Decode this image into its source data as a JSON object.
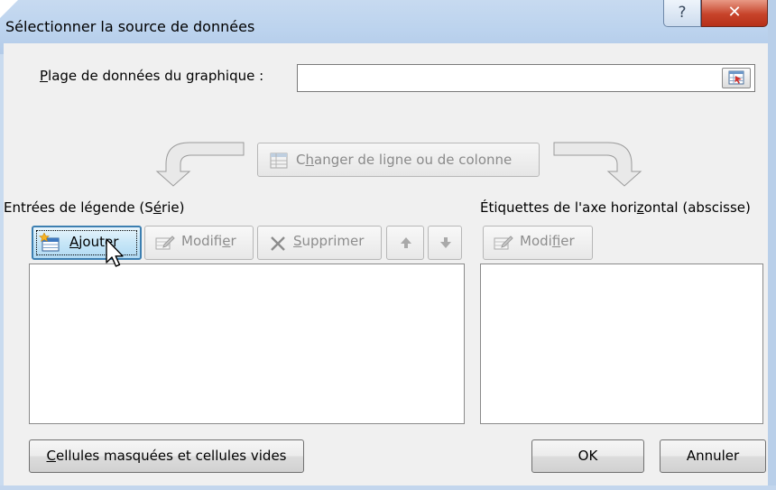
{
  "window": {
    "title": "Sélectionner la source de données",
    "help_glyph": "?",
    "close_glyph": "✕"
  },
  "range": {
    "label_mnemonic": "P",
    "label_rest": "lage de données du graphique :",
    "value": ""
  },
  "switch_button": {
    "pre": "C",
    "mnemonic": "h",
    "post": "anger de ligne ou de colonne",
    "enabled": false
  },
  "legend": {
    "label_pre": "Entrées de légende (S",
    "label_mnemonic": "é",
    "label_post": "rie)",
    "add": {
      "mnemonic": "A",
      "rest": "jouter"
    },
    "edit": {
      "pre": "Modifi",
      "mnemonic": "e",
      "post": "r"
    },
    "delete": {
      "mnemonic": "S",
      "rest": "upprimer"
    },
    "items": []
  },
  "axis": {
    "label_pre": "Étiquettes de l'axe hori",
    "label_mnemonic": "z",
    "label_post": "ontal (abscisse)",
    "edit": {
      "pre": "Modi",
      "mnemonic": "f",
      "post": "ier"
    },
    "items": []
  },
  "footer": {
    "hidden_cells": {
      "mnemonic": "C",
      "rest": "ellules masquées et cellules vides"
    },
    "ok": "OK",
    "cancel": "Annuler"
  },
  "colors": {
    "titlebar": "#bcd3ee",
    "close_button": "#c7432a",
    "dialog_background": "#f0f0f0",
    "focused_button": "#c7e6f7"
  }
}
